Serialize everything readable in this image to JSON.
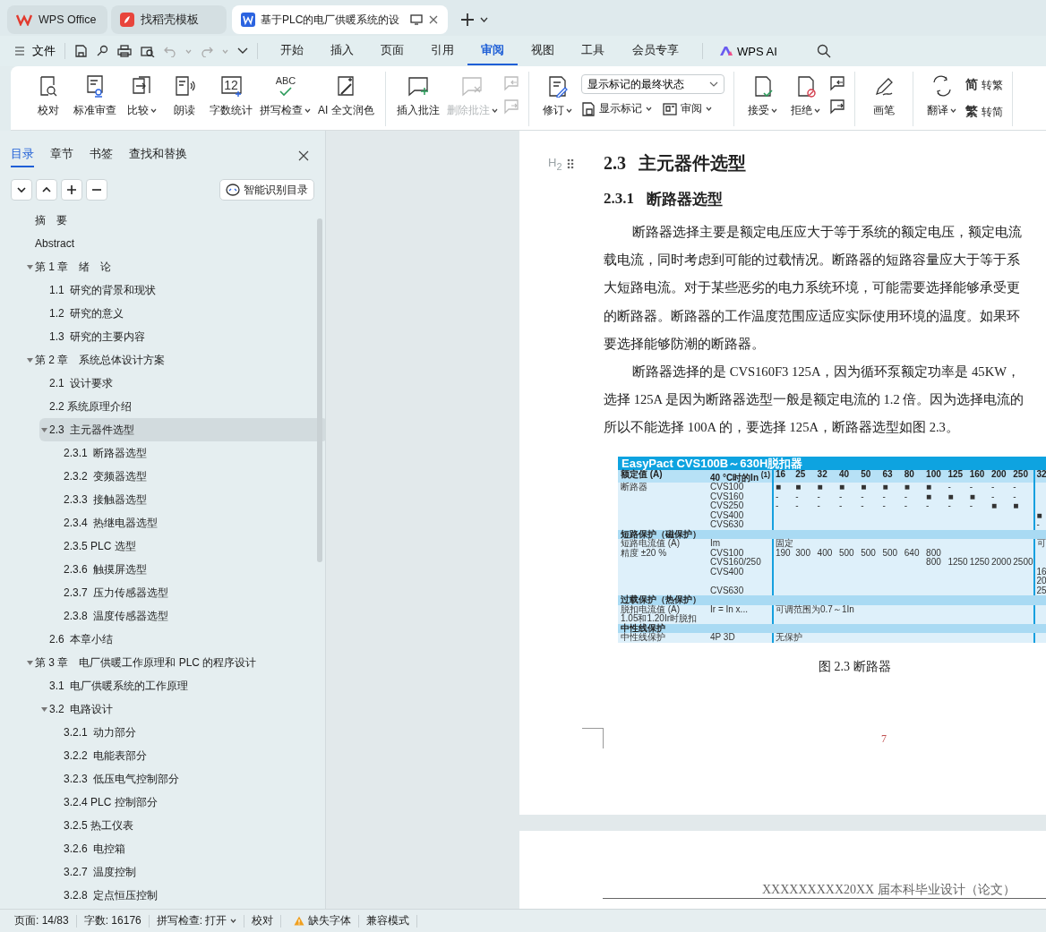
{
  "tabs": [
    {
      "kind": "home",
      "label": "WPS Office",
      "selected": false
    },
    {
      "kind": "template",
      "label": "找稻壳模板",
      "selected": false
    },
    {
      "kind": "doc",
      "label": "基于PLC的电厂供暖系统的设",
      "selected": true
    }
  ],
  "menu": {
    "file": "文件",
    "tabs": [
      {
        "label": "开始",
        "selected": false
      },
      {
        "label": "插入",
        "selected": false
      },
      {
        "label": "页面",
        "selected": false
      },
      {
        "label": "引用",
        "selected": false
      },
      {
        "label": "审阅",
        "selected": true
      },
      {
        "label": "视图",
        "selected": false
      },
      {
        "label": "工具",
        "selected": false
      },
      {
        "label": "会员专享",
        "selected": false
      }
    ],
    "ai": "WPS AI"
  },
  "ribbon": [
    {
      "items": [
        {
          "kind": "big",
          "label": "校对",
          "caret": false,
          "disabled": false
        },
        {
          "kind": "big",
          "label": "标准审查",
          "caret": false,
          "disabled": false
        },
        {
          "kind": "big",
          "label": "比较",
          "caret": true,
          "disabled": false
        },
        {
          "kind": "big",
          "label": "朗读",
          "caret": false,
          "disabled": false
        },
        {
          "kind": "big",
          "label": "字数统计",
          "caret": false,
          "disabled": false,
          "glyph": "12"
        },
        {
          "kind": "big",
          "label": "拼写检查",
          "caret": true,
          "disabled": false,
          "glyph": "ABC"
        },
        {
          "kind": "big",
          "label": "AI 全文润色",
          "caret": false,
          "disabled": false
        }
      ]
    },
    {
      "items": [
        {
          "kind": "big",
          "label": "插入批注",
          "caret": false,
          "disabled": false
        },
        {
          "kind": "big",
          "label": "删除批注",
          "caret": true,
          "disabled": true
        },
        {
          "kind": "icon_stack",
          "buttons": [
            {
              "disabled": true
            },
            {
              "disabled": true
            }
          ]
        }
      ]
    },
    {
      "items": [
        {
          "kind": "big",
          "label": "修订",
          "caret": true,
          "disabled": false
        },
        {
          "kind": "mode",
          "value": "显示标记的最终状态",
          "buttons": [
            {
              "label": "显示标记",
              "caret": true
            },
            {
              "label": "审阅",
              "caret": true
            }
          ]
        }
      ]
    },
    {
      "items": [
        {
          "kind": "big",
          "label": "接受",
          "caret": true,
          "disabled": false
        },
        {
          "kind": "big",
          "label": "拒绝",
          "caret": true,
          "disabled": false
        },
        {
          "kind": "icon_stack",
          "buttons": [
            {
              "disabled": false
            },
            {
              "disabled": false
            }
          ]
        }
      ]
    },
    {
      "items": [
        {
          "kind": "big",
          "label": "画笔",
          "caret": false,
          "disabled": false
        }
      ]
    },
    {
      "items": [
        {
          "kind": "big",
          "label": "翻译",
          "caret": true,
          "disabled": false
        },
        {
          "kind": "text_stack",
          "buttons": [
            {
              "glyph": "简",
              "label": "转繁"
            },
            {
              "glyph": "繁",
              "label": "转简"
            }
          ]
        }
      ]
    }
  ],
  "nav_panel": {
    "tabs": [
      {
        "label": "目录",
        "selected": true
      },
      {
        "label": "章节",
        "selected": false
      },
      {
        "label": "书签",
        "selected": false
      },
      {
        "label": "查找和替换",
        "selected": false
      }
    ],
    "smart_button": "智能识别目录",
    "toc": [
      {
        "label": "摘　要",
        "selected": false
      },
      {
        "label": "Abstract",
        "selected": false
      },
      {
        "label": "第 1 章　绪　论",
        "selected": false,
        "expanded": true,
        "children": [
          {
            "label": "1.1  研究的背景和现状",
            "selected": false
          },
          {
            "label": "1.2  研究的意义",
            "selected": false
          },
          {
            "label": "1.3  研究的主要内容",
            "selected": false
          }
        ]
      },
      {
        "label": "第 2 章　系统总体设计方案",
        "selected": false,
        "expanded": true,
        "children": [
          {
            "label": "2.1  设计要求",
            "selected": false
          },
          {
            "label": "2.2 系统原理介绍",
            "selected": false
          },
          {
            "label": "2.3  主元器件选型",
            "selected": true,
            "expanded": true,
            "children": [
              {
                "label": "2.3.1  断路器选型",
                "selected": false
              },
              {
                "label": "2.3.2  变频器选型",
                "selected": false
              },
              {
                "label": "2.3.3  接触器选型",
                "selected": false
              },
              {
                "label": "2.3.4  热继电器选型",
                "selected": false
              },
              {
                "label": "2.3.5 PLC 选型",
                "selected": false
              },
              {
                "label": "2.3.6  触摸屏选型",
                "selected": false
              },
              {
                "label": "2.3.7  压力传感器选型",
                "selected": false
              },
              {
                "label": "2.3.8  温度传感器选型",
                "selected": false
              }
            ]
          },
          {
            "label": "2.6  本章小结",
            "selected": false
          }
        ]
      },
      {
        "label": "第 3 章　电厂供暖工作原理和 PLC 的程序设计",
        "selected": false,
        "expanded": true,
        "children": [
          {
            "label": "3.1  电厂供暖系统的工作原理",
            "selected": false
          },
          {
            "label": "3.2  电路设计",
            "selected": false,
            "expanded": true,
            "children": [
              {
                "label": "3.2.1  动力部分",
                "selected": false
              },
              {
                "label": "3.2.2  电能表部分",
                "selected": false
              },
              {
                "label": "3.2.3  低压电气控制部分",
                "selected": false
              },
              {
                "label": "3.2.4 PLC 控制部分",
                "selected": false
              },
              {
                "label": "3.2.5 热工仪表",
                "selected": false
              },
              {
                "label": "3.2.6  电控箱",
                "selected": false
              },
              {
                "label": "3.2.7  温度控制",
                "selected": false
              },
              {
                "label": "3.2.8  定点恒压控制",
                "selected": false
              }
            ]
          }
        ]
      }
    ]
  },
  "document": {
    "heading_marker": "H$_{2}$",
    "heading": {
      "number": "2.3",
      "title": "主元器件选型"
    },
    "subheading": {
      "number": "2.3.1",
      "title": "断路器选型"
    },
    "paragraphs": [
      [
        "断路器选择主要是额定电压应大于等于系统的额定电压，额定电流",
        "载电流，同时考虑到可能的过载情况。断路器的短路容量应大于等于系",
        "大短路电流。对于某些恶劣的电力系统环境，可能需要选择能够承受更",
        "的断路器。断路器的工作温度范围应适应实际使用环境的温度。如果环",
        "要选择能够防潮的断路器。"
      ],
      [
        "断路器选择的是 CVS160F3 125A，因为循环泵额定功率是 45KW，",
        "选择 125A 是因为断路器选型一般是额定电流的 1.2 倍。因为选择电流的",
        "所以不能选择 100A 的，要选择 125A，断路器选型如图 2.3。"
      ]
    ],
    "figure": {
      "rows": [
        {
          "kind": "title",
          "label": "EasyPact CVS100B～630H脱扣器"
        },
        {
          "kind": "header",
          "label": "额定值 (A)",
          "sub": "40 °C时的In $^{(1)}$",
          "values": [
            {
              "kind": "v",
              "text": "16"
            },
            {
              "kind": "v",
              "text": "25"
            },
            {
              "kind": "v",
              "text": "32"
            },
            {
              "kind": "v",
              "text": "40"
            },
            {
              "kind": "v",
              "text": "50"
            },
            {
              "kind": "v",
              "text": "63"
            },
            {
              "kind": "v",
              "text": "80"
            },
            {
              "kind": "v",
              "text": "100"
            },
            {
              "kind": "v",
              "text": "125"
            },
            {
              "kind": "v",
              "text": "160"
            },
            {
              "kind": "v",
              "text": "200"
            },
            {
              "kind": "v",
              "text": "250"
            },
            {
              "kind": "v",
              "text": "32"
            }
          ]
        },
        {
          "kind": "data",
          "label": "断路器",
          "sub": "CVS100",
          "values": [
            {
              "kind": "v",
              "text": "■"
            },
            {
              "kind": "v",
              "text": "■"
            },
            {
              "kind": "v",
              "text": "■"
            },
            {
              "kind": "v",
              "text": "■"
            },
            {
              "kind": "v",
              "text": "■"
            },
            {
              "kind": "v",
              "text": "■"
            },
            {
              "kind": "v",
              "text": "■"
            },
            {
              "kind": "v",
              "text": "■"
            },
            {
              "kind": "v",
              "text": "-"
            },
            {
              "kind": "v",
              "text": "-"
            },
            {
              "kind": "v",
              "text": "-"
            },
            {
              "kind": "v",
              "text": "-"
            },
            {
              "kind": "blank"
            }
          ]
        },
        {
          "kind": "data",
          "sub": "CVS160",
          "values": [
            {
              "kind": "v",
              "text": "-"
            },
            {
              "kind": "v",
              "text": "-"
            },
            {
              "kind": "v",
              "text": "-"
            },
            {
              "kind": "v",
              "text": "-"
            },
            {
              "kind": "v",
              "text": "-"
            },
            {
              "kind": "v",
              "text": "-"
            },
            {
              "kind": "v",
              "text": "-"
            },
            {
              "kind": "v",
              "text": "■"
            },
            {
              "kind": "v",
              "text": "■"
            },
            {
              "kind": "v",
              "text": "■"
            },
            {
              "kind": "v",
              "text": "-"
            },
            {
              "kind": "v",
              "text": "-"
            },
            {
              "kind": "blank"
            }
          ]
        },
        {
          "kind": "data",
          "sub": "CVS250",
          "values": [
            {
              "kind": "v",
              "text": "-"
            },
            {
              "kind": "v",
              "text": "-"
            },
            {
              "kind": "v",
              "text": "-"
            },
            {
              "kind": "v",
              "text": "-"
            },
            {
              "kind": "v",
              "text": "-"
            },
            {
              "kind": "v",
              "text": "-"
            },
            {
              "kind": "v",
              "text": "-"
            },
            {
              "kind": "v",
              "text": "-"
            },
            {
              "kind": "v",
              "text": "-"
            },
            {
              "kind": "v",
              "text": "-"
            },
            {
              "kind": "v",
              "text": "■"
            },
            {
              "kind": "v",
              "text": "■"
            },
            {
              "kind": "blank"
            }
          ]
        },
        {
          "kind": "data",
          "sub": "CVS400",
          "values": [
            {
              "kind": "blank"
            },
            {
              "kind": "blank"
            },
            {
              "kind": "blank"
            },
            {
              "kind": "blank"
            },
            {
              "kind": "blank"
            },
            {
              "kind": "blank"
            },
            {
              "kind": "blank"
            },
            {
              "kind": "blank"
            },
            {
              "kind": "blank"
            },
            {
              "kind": "blank"
            },
            {
              "kind": "blank"
            },
            {
              "kind": "blank"
            },
            {
              "kind": "v",
              "text": "■"
            }
          ]
        },
        {
          "kind": "data",
          "sub": "CVS630",
          "values": [
            {
              "kind": "blank"
            },
            {
              "kind": "blank"
            },
            {
              "kind": "blank"
            },
            {
              "kind": "blank"
            },
            {
              "kind": "blank"
            },
            {
              "kind": "blank"
            },
            {
              "kind": "blank"
            },
            {
              "kind": "blank"
            },
            {
              "kind": "blank"
            },
            {
              "kind": "blank"
            },
            {
              "kind": "blank"
            },
            {
              "kind": "blank"
            },
            {
              "kind": "v",
              "text": "-"
            }
          ]
        },
        {
          "kind": "section",
          "label": "短路保护（磁保护）"
        },
        {
          "kind": "data",
          "label": "短路电流值 (A)",
          "sub": "Im",
          "values": [
            {
              "kind": "v",
              "text": "固定"
            },
            {
              "kind": "blank"
            },
            {
              "kind": "blank"
            },
            {
              "kind": "blank"
            },
            {
              "kind": "blank"
            },
            {
              "kind": "blank"
            },
            {
              "kind": "blank"
            },
            {
              "kind": "blank"
            },
            {
              "kind": "blank"
            },
            {
              "kind": "blank"
            },
            {
              "kind": "blank"
            },
            {
              "kind": "blank"
            },
            {
              "kind": "v",
              "text": "可"
            }
          ]
        },
        {
          "kind": "data",
          "label": "精度 ±20 %",
          "sub": "CVS100",
          "values": [
            {
              "kind": "v",
              "text": "190"
            },
            {
              "kind": "v",
              "text": "300"
            },
            {
              "kind": "v",
              "text": "400"
            },
            {
              "kind": "v",
              "text": "500"
            },
            {
              "kind": "v",
              "text": "500"
            },
            {
              "kind": "v",
              "text": "500"
            },
            {
              "kind": "v",
              "text": "640"
            },
            {
              "kind": "v",
              "text": "800"
            },
            {
              "kind": "blank"
            },
            {
              "kind": "blank"
            },
            {
              "kind": "blank"
            },
            {
              "kind": "blank"
            },
            {
              "kind": "blank"
            }
          ]
        },
        {
          "kind": "data",
          "sub": "CVS160/250",
          "values": [
            {
              "kind": "blank"
            },
            {
              "kind": "blank"
            },
            {
              "kind": "blank"
            },
            {
              "kind": "blank"
            },
            {
              "kind": "blank"
            },
            {
              "kind": "blank"
            },
            {
              "kind": "blank"
            },
            {
              "kind": "v",
              "text": "800"
            },
            {
              "kind": "v",
              "text": "1250"
            },
            {
              "kind": "v",
              "text": "1250"
            },
            {
              "kind": "v",
              "text": "2000"
            },
            {
              "kind": "v",
              "text": "2500"
            },
            {
              "kind": "blank"
            }
          ]
        },
        {
          "kind": "data",
          "sub": "CVS400",
          "values": [
            {
              "kind": "blank"
            },
            {
              "kind": "blank"
            },
            {
              "kind": "blank"
            },
            {
              "kind": "blank"
            },
            {
              "kind": "blank"
            },
            {
              "kind": "blank"
            },
            {
              "kind": "blank"
            },
            {
              "kind": "blank"
            },
            {
              "kind": "blank"
            },
            {
              "kind": "blank"
            },
            {
              "kind": "blank"
            },
            {
              "kind": "blank"
            },
            {
              "kind": "v",
              "text": "16"
            }
          ]
        },
        {
          "kind": "data",
          "values": [
            {
              "kind": "blank"
            },
            {
              "kind": "blank"
            },
            {
              "kind": "blank"
            },
            {
              "kind": "blank"
            },
            {
              "kind": "blank"
            },
            {
              "kind": "blank"
            },
            {
              "kind": "blank"
            },
            {
              "kind": "blank"
            },
            {
              "kind": "blank"
            },
            {
              "kind": "blank"
            },
            {
              "kind": "blank"
            },
            {
              "kind": "blank"
            },
            {
              "kind": "v",
              "text": "20"
            }
          ]
        },
        {
          "kind": "data",
          "sub": "CVS630",
          "values": [
            {
              "kind": "blank"
            },
            {
              "kind": "blank"
            },
            {
              "kind": "blank"
            },
            {
              "kind": "blank"
            },
            {
              "kind": "blank"
            },
            {
              "kind": "blank"
            },
            {
              "kind": "blank"
            },
            {
              "kind": "blank"
            },
            {
              "kind": "blank"
            },
            {
              "kind": "blank"
            },
            {
              "kind": "blank"
            },
            {
              "kind": "blank"
            },
            {
              "kind": "v",
              "text": "25"
            }
          ]
        },
        {
          "kind": "section",
          "label": "过载保护（热保护）"
        },
        {
          "kind": "data",
          "label": "脱扣电流值 (A)",
          "sub": "Ir = In x...",
          "values": [
            {
              "kind": "v",
              "text": "可调范围为0.7～1In"
            },
            {
              "kind": "blank"
            },
            {
              "kind": "blank"
            },
            {
              "kind": "blank"
            },
            {
              "kind": "blank"
            },
            {
              "kind": "blank"
            },
            {
              "kind": "blank"
            },
            {
              "kind": "blank"
            },
            {
              "kind": "blank"
            },
            {
              "kind": "blank"
            },
            {
              "kind": "blank"
            },
            {
              "kind": "blank"
            },
            {
              "kind": "blank"
            }
          ]
        },
        {
          "kind": "data",
          "label": "1.05和1.20Ir时脱扣",
          "values": [
            {
              "kind": "blank"
            },
            {
              "kind": "blank"
            },
            {
              "kind": "blank"
            },
            {
              "kind": "blank"
            },
            {
              "kind": "blank"
            },
            {
              "kind": "blank"
            },
            {
              "kind": "blank"
            },
            {
              "kind": "blank"
            },
            {
              "kind": "blank"
            },
            {
              "kind": "blank"
            },
            {
              "kind": "blank"
            },
            {
              "kind": "blank"
            },
            {
              "kind": "blank"
            }
          ]
        },
        {
          "kind": "section",
          "label": "中性线保护"
        },
        {
          "kind": "data",
          "label": "中性线保护",
          "sub": "4P 3D",
          "values": [
            {
              "kind": "v",
              "text": "无保护"
            },
            {
              "kind": "blank"
            },
            {
              "kind": "blank"
            },
            {
              "kind": "blank"
            },
            {
              "kind": "blank"
            },
            {
              "kind": "blank"
            },
            {
              "kind": "blank"
            },
            {
              "kind": "blank"
            },
            {
              "kind": "blank"
            },
            {
              "kind": "blank"
            },
            {
              "kind": "blank"
            },
            {
              "kind": "blank"
            },
            {
              "kind": "blank"
            }
          ]
        }
      ]
    },
    "caption": "图 2.3  断路器",
    "page_number": "7",
    "next_page_header": "XXXXXXXXX20XX 届本科毕业设计（论文）"
  },
  "status_bar": [
    {
      "kind": "text",
      "label": "页面: 14/83"
    },
    {
      "kind": "text",
      "label": "字数: 16176"
    },
    {
      "kind": "dropdown",
      "label": "拼写检查: 打开"
    },
    {
      "kind": "button",
      "label": "校对"
    },
    {
      "kind": "warning",
      "label": "缺失字体"
    },
    {
      "kind": "button",
      "label": "兼容模式"
    }
  ]
}
